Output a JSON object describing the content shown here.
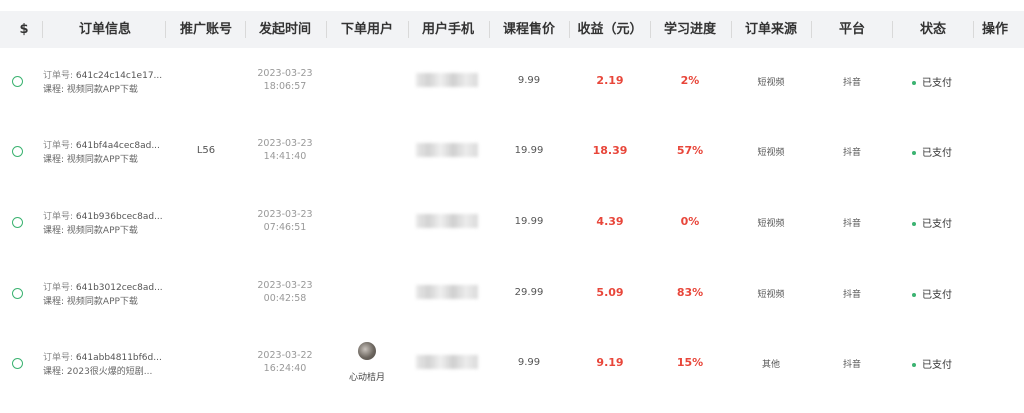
{
  "header": {
    "dollar": "$",
    "order_info": "订单信息",
    "promo_account": "推广账号",
    "launch_time": "发起时间",
    "order_user": "下单用户",
    "user_phone": "用户手机",
    "course_price": "课程售价",
    "income": "收益（元）",
    "progress": "学习进度",
    "order_source": "订单来源",
    "platform": "平台",
    "status": "状态",
    "actions": "操作"
  },
  "labels": {
    "order_no": "订单号: ",
    "course": "课程: "
  },
  "rows": [
    {
      "order_no": "641c24c14c1e17...",
      "course": "视频同款APP下载",
      "promo_account": "",
      "date": "2023-03-23",
      "time": "18:06:57",
      "user_name": "",
      "price": "9.99",
      "income": "2.19",
      "progress": "2%",
      "source": "短视频",
      "platform": "抖音",
      "status": "已支付"
    },
    {
      "order_no": "641bf4a4cec8ad...",
      "course": "视频同款APP下载",
      "promo_account": "L56",
      "date": "2023-03-23",
      "time": "14:41:40",
      "user_name": "",
      "price": "19.99",
      "income": "18.39",
      "progress": "57%",
      "source": "短视频",
      "platform": "抖音",
      "status": "已支付"
    },
    {
      "order_no": "641b936bcec8ad...",
      "course": "视频同款APP下载",
      "promo_account": "",
      "date": "2023-03-23",
      "time": "07:46:51",
      "user_name": "",
      "price": "19.99",
      "income": "4.39",
      "progress": "0%",
      "source": "短视频",
      "platform": "抖音",
      "status": "已支付"
    },
    {
      "order_no": "641b3012cec8ad...",
      "course": "视频同款APP下载",
      "promo_account": "",
      "date": "2023-03-23",
      "time": "00:42:58",
      "user_name": "",
      "price": "29.99",
      "income": "5.09",
      "progress": "83%",
      "source": "短视频",
      "platform": "抖音",
      "status": "已支付"
    },
    {
      "order_no": "641abb4811bf6d...",
      "course": "2023很火爆的短剧...",
      "promo_account": "",
      "date": "2023-03-22",
      "time": "16:24:40",
      "user_name": "心动桔月",
      "price": "9.99",
      "income": "9.19",
      "progress": "15%",
      "source": "其他",
      "platform": "抖音",
      "status": "已支付"
    }
  ],
  "colors": {
    "header_bg": "#f2f3f5",
    "income_red": "#e8463a",
    "status_green": "#3cb371"
  }
}
